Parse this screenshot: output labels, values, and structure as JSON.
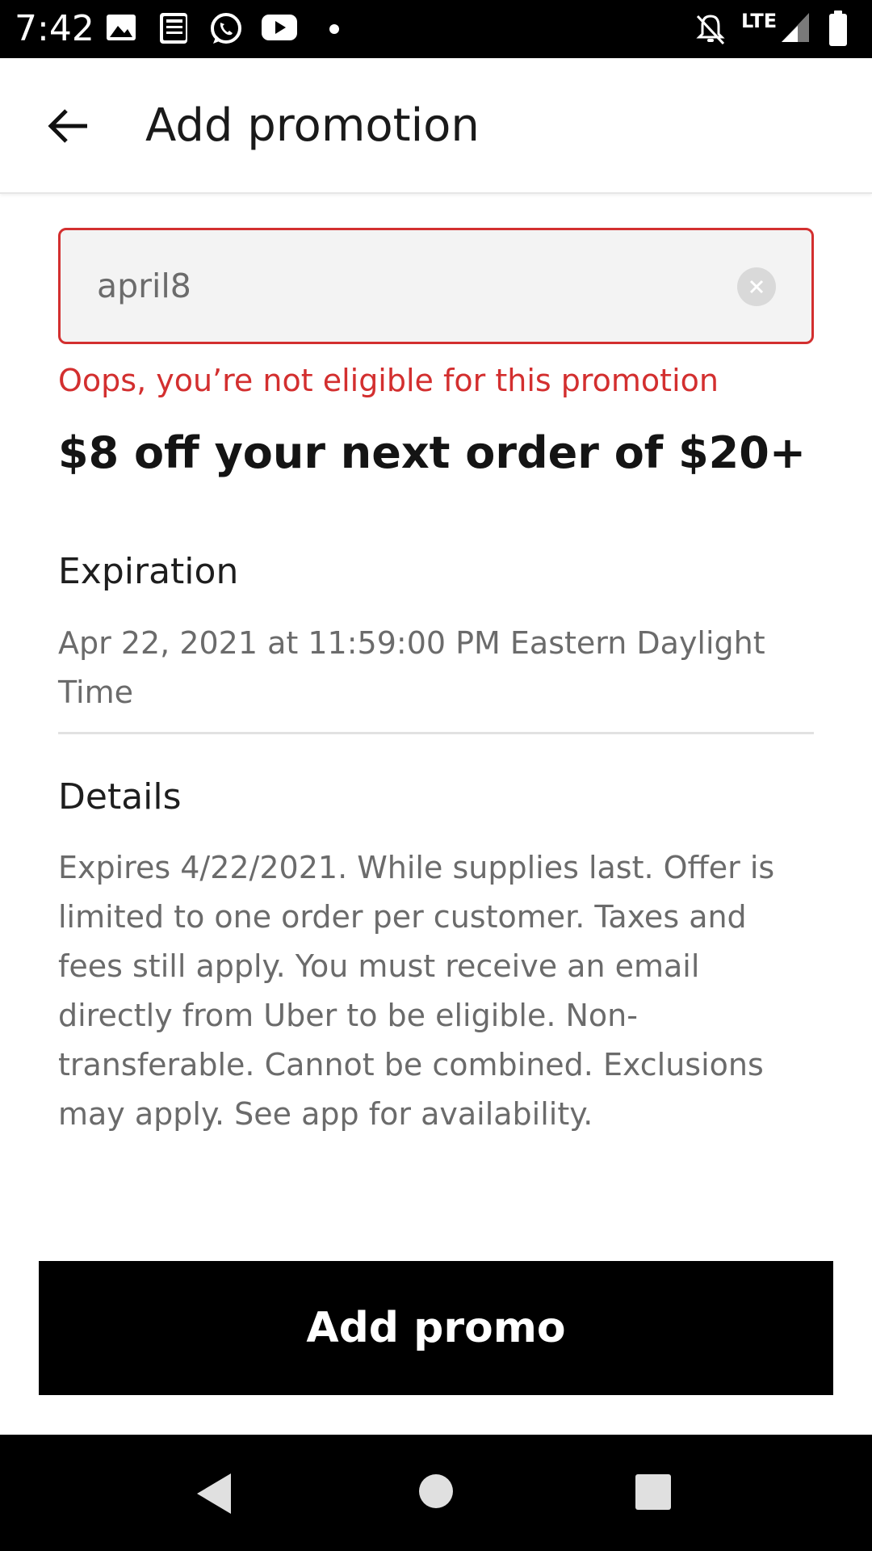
{
  "status_bar": {
    "time": "7:42",
    "network": "LTE",
    "icons": [
      "image-icon",
      "news-icon",
      "whatsapp-icon",
      "youtube-icon",
      "dot-icon",
      "notifications-off-icon",
      "signal-icon",
      "battery-icon"
    ]
  },
  "header": {
    "title": "Add promotion",
    "back_icon": "arrow-left-icon"
  },
  "promo": {
    "code_value": "april8",
    "clear_icon": "close-circle-icon",
    "error": "Oops, you’re not eligible for this promotion",
    "headline": "$8 off your next order of $20+"
  },
  "expiration": {
    "heading": "Expiration",
    "value": "Apr 22, 2021 at 11:59:00 PM Eastern Daylight Time"
  },
  "details": {
    "heading": "Details",
    "text": "Expires 4/22/2021. While supplies last.  Offer is limited to one order per customer. Taxes and fees still apply. You must receive an email directly from Uber to be eligible. Non-transferable. Cannot be combined. Exclusions may apply. See app for availability."
  },
  "actions": {
    "add_promo_label": "Add promo"
  },
  "nav_bar": {
    "icons": [
      "back-triangle-icon",
      "home-circle-icon",
      "recents-square-icon"
    ]
  },
  "colors": {
    "error": "#d32f2f",
    "primary_button": "#000000",
    "field_background": "#f3f3f3"
  }
}
